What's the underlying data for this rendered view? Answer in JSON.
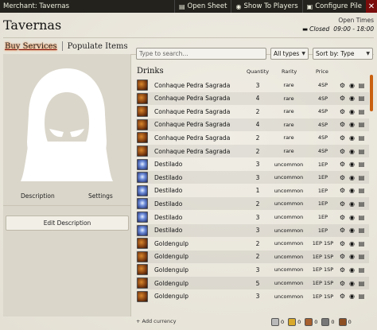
{
  "window": {
    "title": "Merchant: Tavernas",
    "open_sheet_label": "Open Sheet",
    "show_players_label": "Show To Players",
    "configure_pile_label": "Configure Pile",
    "close_glyph": "✕"
  },
  "pile": {
    "name": "Tavernas",
    "open_times_label": "Open Times",
    "status": "Closed",
    "hours": "09:00 - 18:00"
  },
  "tabs": [
    {
      "label": "Buy Services",
      "active": true
    },
    {
      "label": "Populate Items",
      "active": false
    }
  ],
  "left_panel": {
    "description_tab": "Description",
    "settings_tab": "Settings",
    "edit_description_label": "Edit Description"
  },
  "filters": {
    "search_placeholder": "Type to search...",
    "type_select": "All types",
    "sort_select": "Sort by: Type"
  },
  "list": {
    "category": "Drinks",
    "columns": {
      "quantity": "Quantity",
      "rarity": "Rarity",
      "price": "Price"
    },
    "items": [
      {
        "name": "Conhaque Pedra Sagrada",
        "qty": "3",
        "rarity": "rare",
        "price": "4SP",
        "icon": "brandy-icon"
      },
      {
        "name": "Conhaque Pedra Sagrada",
        "qty": "4",
        "rarity": "rare",
        "price": "4SP",
        "icon": "brandy-icon"
      },
      {
        "name": "Conhaque Pedra Sagrada",
        "qty": "2",
        "rarity": "rare",
        "price": "4SP",
        "icon": "brandy-icon"
      },
      {
        "name": "Conhaque Pedra Sagrada",
        "qty": "4",
        "rarity": "rare",
        "price": "4SP",
        "icon": "brandy-icon"
      },
      {
        "name": "Conhaque Pedra Sagrada",
        "qty": "2",
        "rarity": "rare",
        "price": "4SP",
        "icon": "brandy-icon"
      },
      {
        "name": "Conhaque Pedra Sagrada",
        "qty": "2",
        "rarity": "rare",
        "price": "4SP",
        "icon": "brandy-icon"
      },
      {
        "name": "Destilado",
        "qty": "3",
        "rarity": "uncommon",
        "price": "1EP",
        "icon": "distillate-icon"
      },
      {
        "name": "Destilado",
        "qty": "3",
        "rarity": "uncommon",
        "price": "1EP",
        "icon": "distillate-icon"
      },
      {
        "name": "Destilado",
        "qty": "1",
        "rarity": "uncommon",
        "price": "1EP",
        "icon": "distillate-icon"
      },
      {
        "name": "Destilado",
        "qty": "2",
        "rarity": "uncommon",
        "price": "1EP",
        "icon": "distillate-icon"
      },
      {
        "name": "Destilado",
        "qty": "3",
        "rarity": "uncommon",
        "price": "1EP",
        "icon": "distillate-icon"
      },
      {
        "name": "Destilado",
        "qty": "3",
        "rarity": "uncommon",
        "price": "1EP",
        "icon": "distillate-icon"
      },
      {
        "name": "Goldengulp",
        "qty": "2",
        "rarity": "uncommon",
        "price": "1EP 1SP",
        "icon": "brandy-icon"
      },
      {
        "name": "Goldengulp",
        "qty": "2",
        "rarity": "uncommon",
        "price": "1EP 1SP",
        "icon": "brandy-icon"
      },
      {
        "name": "Goldengulp",
        "qty": "3",
        "rarity": "uncommon",
        "price": "1EP 1SP",
        "icon": "brandy-icon"
      },
      {
        "name": "Goldengulp",
        "qty": "5",
        "rarity": "uncommon",
        "price": "1EP 1SP",
        "icon": "brandy-icon"
      },
      {
        "name": "Goldengulp",
        "qty": "3",
        "rarity": "uncommon",
        "price": "1EP 1SP",
        "icon": "brandy-icon"
      }
    ]
  },
  "footer": {
    "add_currency_label": "+ Add currency",
    "currencies": [
      {
        "code": "pp",
        "value": "0"
      },
      {
        "code": "gp",
        "value": "0"
      },
      {
        "code": "ep",
        "value": "0"
      },
      {
        "code": "sp",
        "value": "0"
      },
      {
        "code": "cp",
        "value": "0"
      }
    ]
  }
}
